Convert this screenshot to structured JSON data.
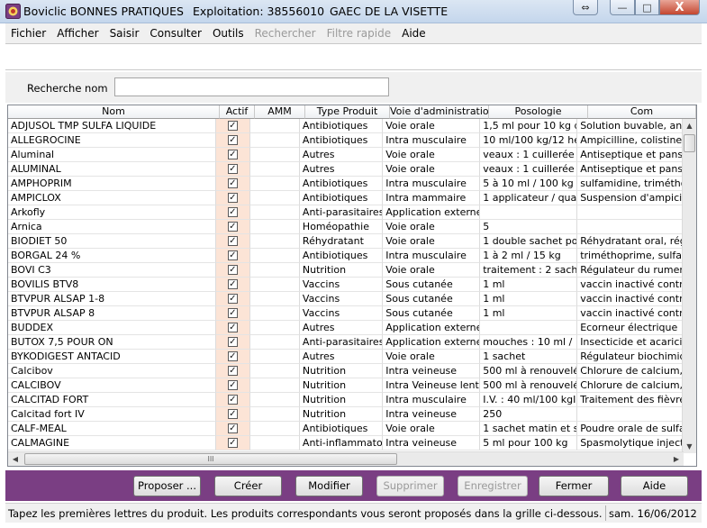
{
  "window": {
    "app_title": "Boviclic BONNES PRATIQUES",
    "exploitation": "Exploitation: 38556010",
    "gaec": "GAEC DE LA VISETTE",
    "close_glyph": "X",
    "minimize_glyph": "—",
    "maximize_glyph": "□",
    "restore_glyph": "⇔"
  },
  "menu": [
    {
      "label": "Fichier",
      "enabled": true
    },
    {
      "label": "Afficher",
      "enabled": true
    },
    {
      "label": "Saisir",
      "enabled": true
    },
    {
      "label": "Consulter",
      "enabled": true
    },
    {
      "label": "Outils",
      "enabled": true
    },
    {
      "label": "Rechercher",
      "enabled": false
    },
    {
      "label": "Filtre rapide",
      "enabled": false
    },
    {
      "label": "Aide",
      "enabled": true
    }
  ],
  "search": {
    "label": "Recherche nom",
    "value": ""
  },
  "grid": {
    "columns": [
      "Nom",
      "Actif",
      "AMM",
      "Type Produit",
      "Voie d'administration",
      "Posologie",
      "Com"
    ],
    "rows": [
      [
        "ADJUSOL TMP SULFA LIQUIDE",
        true,
        "",
        "Antibiotiques",
        "Voie orale",
        "1,5 ml pour 10 kg de p",
        "Solution buvable, antib"
      ],
      [
        "ALLEGROCINE",
        true,
        "",
        "Antibiotiques",
        "Intra musculaire",
        "10 ml/100 kg/12 heur",
        "Ampicilline, colistine, d"
      ],
      [
        "Aluminal",
        true,
        "",
        "Autres",
        "Voie orale",
        "veaux : 1 cuillerée à s",
        "Antiseptique et panse"
      ],
      [
        "ALUMINAL",
        true,
        "",
        "Autres",
        "Voie orale",
        "veaux : 1 cuillerée à s",
        "Antiseptique et panse"
      ],
      [
        "AMPHOPRIM",
        true,
        "",
        "Antibiotiques",
        "Intra musculaire",
        "5 à 10 ml / 100 kg / j",
        "sulfamidine, triméthop"
      ],
      [
        "AMPICLOX",
        true,
        "",
        "Antibiotiques",
        "Intra mammaire",
        "1 applicateur / quartie",
        "Suspension d'ampicill"
      ],
      [
        "Arkofly",
        true,
        "",
        "Anti-parasitaires",
        "Application externe",
        "",
        ""
      ],
      [
        "Arnica",
        true,
        "",
        "Homéopathie",
        "Voie orale",
        "5",
        ""
      ],
      [
        "BIODIET 50",
        true,
        "",
        "Réhydratant",
        "Voie orale",
        "1 double sachet pour",
        "Réhydratant oral, régu"
      ],
      [
        "BORGAL 24 %",
        true,
        "",
        "Antibiotiques",
        "Intra musculaire",
        "1 à 2 ml / 15 kg",
        "triméthoprime,  sulfad"
      ],
      [
        "BOVI C3",
        true,
        "",
        "Nutrition",
        "Voie orale",
        "traitement : 2 sachet /",
        "Régulateur du rumen"
      ],
      [
        "BOVILIS BTV8",
        true,
        "",
        "Vaccins",
        "Sous cutanée",
        "1 ml",
        "vaccin inactivé contre"
      ],
      [
        "BTVPUR ALSAP 1-8",
        true,
        "",
        "Vaccins",
        "Sous cutanée",
        "1 ml",
        "vaccin inactivé contre"
      ],
      [
        "BTVPUR ALSAP 8",
        true,
        "",
        "Vaccins",
        "Sous cutanée",
        "1 ml",
        "vaccin inactivé contre"
      ],
      [
        "BUDDEX",
        true,
        "",
        "Autres",
        "Application externe",
        "",
        "Ecorneur électrique"
      ],
      [
        "BUTOX 7,5 POUR ON",
        true,
        "",
        "Anti-parasitaires",
        "Application externe",
        "mouches : 10 ml / 100",
        "Insecticide et acaricid"
      ],
      [
        "BYKODIGEST ANTACID",
        true,
        "",
        "Autres",
        "Voie orale",
        "1 sachet",
        "Régulateur biochimiqu"
      ],
      [
        "Calcibov",
        true,
        "",
        "Nutrition",
        "Intra veineuse",
        "500 ml à renouvelée s",
        "Chlorure de calcium, C"
      ],
      [
        "CALCIBOV",
        true,
        "",
        "Nutrition",
        "Intra Veineuse lente",
        "500 ml à renouvelée s",
        "Chlorure de calcium, C"
      ],
      [
        "CALCITAD FORT",
        true,
        "",
        "Nutrition",
        "Intra musculaire",
        "I.V. : 40 ml/100 kgI.M",
        "Traitement des fièvres"
      ],
      [
        "Calcitad fort IV",
        true,
        "",
        "Nutrition",
        "Intra veineuse",
        "250",
        ""
      ],
      [
        "CALF-MEAL",
        true,
        "",
        "Antibiotiques",
        "Voie orale",
        "1 sachet matin et soir",
        "Poudre orale de sulfac"
      ],
      [
        "CALMAGINE",
        true,
        "",
        "Anti-inflammatoires",
        "Intra veineuse",
        "5 ml pour 100 kg",
        "Spasmolytique injecta"
      ]
    ]
  },
  "scroll": {
    "up": "▲",
    "down": "▼",
    "left": "◀",
    "right": "▶",
    "thumb_grip": "III"
  },
  "buttons": [
    {
      "key": "proposer",
      "label": "Proposer ...",
      "enabled": true
    },
    {
      "key": "creer",
      "label": "Créer",
      "enabled": true
    },
    {
      "key": "modifier",
      "label": "Modifier",
      "enabled": true
    },
    {
      "key": "supprimer",
      "label": "Supprimer",
      "enabled": false
    },
    {
      "key": "enregistrer",
      "label": "Enregistrer",
      "enabled": false
    },
    {
      "key": "fermer",
      "label": "Fermer",
      "enabled": true
    },
    {
      "key": "aide",
      "label": "Aide",
      "enabled": true
    }
  ],
  "status": {
    "message": "Tapez les premières lettres du produit. Les produits correspondants vous seront proposés dans la grille ci-dessous.",
    "date": "sam. 16/06/2012"
  },
  "colors": {
    "button_bar": "#7a3e83",
    "actif_column": "#fce4d6"
  }
}
